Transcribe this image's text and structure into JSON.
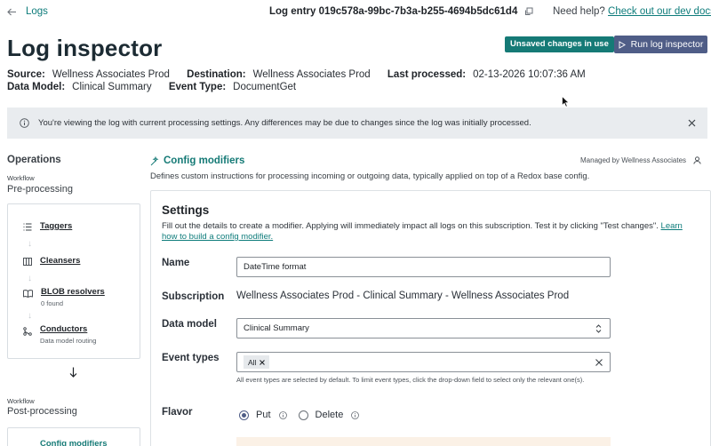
{
  "header": {
    "back_label": "Logs",
    "entry_title": "Log entry 019c578a-99bc-7b3a-b255-4694b5dc61d4",
    "help_text": "Need help?",
    "help_link": "Check out our dev docs."
  },
  "page": {
    "title": "Log inspector",
    "unsaved_badge": "Unsaved changes in use",
    "run_button": "Run log inspector"
  },
  "meta": {
    "source_label": "Source:",
    "source_value": "Wellness Associates Prod",
    "destination_label": "Destination:",
    "destination_value": "Wellness Associates Prod",
    "last_processed_label": "Last processed:",
    "last_processed_value": "02-13-2026 10:07:36 AM",
    "data_model_label": "Data Model:",
    "data_model_value": "Clinical Summary",
    "event_type_label": "Event Type:",
    "event_type_value": "DocumentGet"
  },
  "banner": {
    "text": "You're viewing the log with current processing settings. Any differences may be due to changes since the log was initially processed."
  },
  "operations": {
    "title": "Operations",
    "pre": {
      "workflow_label": "Workflow",
      "name": "Pre-processing",
      "items": [
        {
          "label": "Taggers",
          "sub": ""
        },
        {
          "label": "Cleansers",
          "sub": ""
        },
        {
          "label": "BLOB resolvers",
          "sub": "0 found"
        },
        {
          "label": "Conductors",
          "sub": "Data model routing"
        }
      ]
    },
    "post": {
      "workflow_label": "Workflow",
      "name": "Post-processing",
      "first_item": "Config modifiers"
    }
  },
  "config": {
    "title": "Config modifiers",
    "managed_by": "Managed by Wellness Associates",
    "description": "Defines custom instructions for processing incoming or outgoing data, typically applied on top of a Redox base config."
  },
  "settings": {
    "title": "Settings",
    "description": "Fill out the details to create a modifier. Applying will immediately impact all logs on this subscription. Test it by clicking \"Test changes\".",
    "learn_link": "Learn how to build a config modifier.",
    "name_label": "Name",
    "name_value": "DateTime format",
    "subscription_label": "Subscription",
    "subscription_value": "Wellness Associates Prod - Clinical Summary - Wellness Associates Prod",
    "data_model_label": "Data model",
    "data_model_value": "Clinical Summary",
    "event_types_label": "Event types",
    "event_types_chip": "All",
    "event_types_hint": "All event types are selected by default. To limit event types, click the drop-down field to select only the relevant one(s).",
    "flavor_label": "Flavor",
    "flavor_options": [
      "Put",
      "Delete"
    ],
    "flavor_selected": "Put"
  },
  "colors": {
    "accent": "#157a76",
    "link": "#0e7c7b",
    "primary_button": "#4f5d87",
    "banner_bg": "#e9ecef"
  }
}
